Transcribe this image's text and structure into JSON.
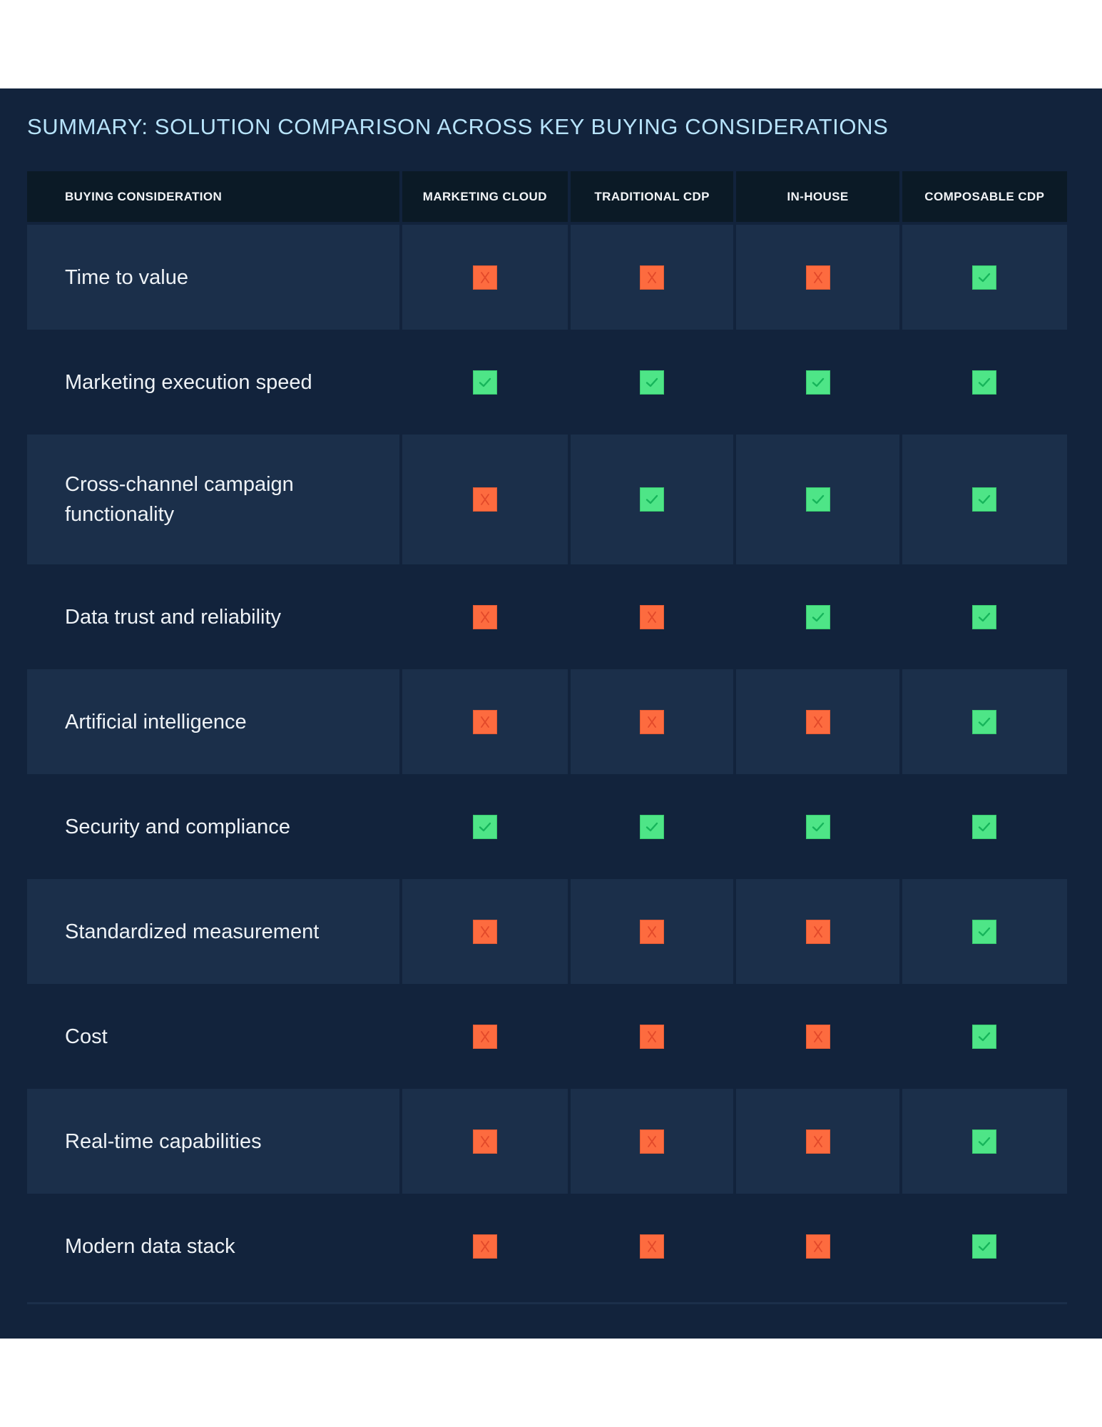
{
  "title": "SUMMARY: SOLUTION COMPARISON ACROSS KEY BUYING CONSIDERATIONS",
  "colors": {
    "panel_bg": "#12233c",
    "row_alt_bg": "#1b2f4a",
    "header_bg": "#0b1a26",
    "title_color": "#b7e3fb",
    "yes_color": "#4ee587",
    "no_color": "#fd6b3f"
  },
  "table": {
    "headers": [
      "BUYING CONSIDERATION",
      "MARKETING CLOUD",
      "TRADITIONAL CDP",
      "IN-HOUSE",
      "COMPOSABLE CDP"
    ],
    "rows": [
      {
        "label": "Time to value",
        "values": [
          "no",
          "no",
          "no",
          "yes"
        ]
      },
      {
        "label": "Marketing execution speed",
        "values": [
          "yes",
          "yes",
          "yes",
          "yes"
        ]
      },
      {
        "label": "Cross-channel campaign functionality",
        "values": [
          "no",
          "yes",
          "yes",
          "yes"
        ]
      },
      {
        "label": "Data trust and reliability",
        "values": [
          "no",
          "no",
          "yes",
          "yes"
        ]
      },
      {
        "label": "Artificial intelligence",
        "values": [
          "no",
          "no",
          "no",
          "yes"
        ]
      },
      {
        "label": "Security and compliance",
        "values": [
          "yes",
          "yes",
          "yes",
          "yes"
        ]
      },
      {
        "label": "Standardized measurement",
        "values": [
          "no",
          "no",
          "no",
          "yes"
        ]
      },
      {
        "label": "Cost",
        "values": [
          "no",
          "no",
          "no",
          "yes"
        ]
      },
      {
        "label": "Real-time capabilities",
        "values": [
          "no",
          "no",
          "no",
          "yes"
        ]
      },
      {
        "label": "Modern data stack",
        "values": [
          "no",
          "no",
          "no",
          "yes"
        ]
      }
    ]
  },
  "icons": {
    "yes": "check-icon",
    "no": "x-icon"
  }
}
